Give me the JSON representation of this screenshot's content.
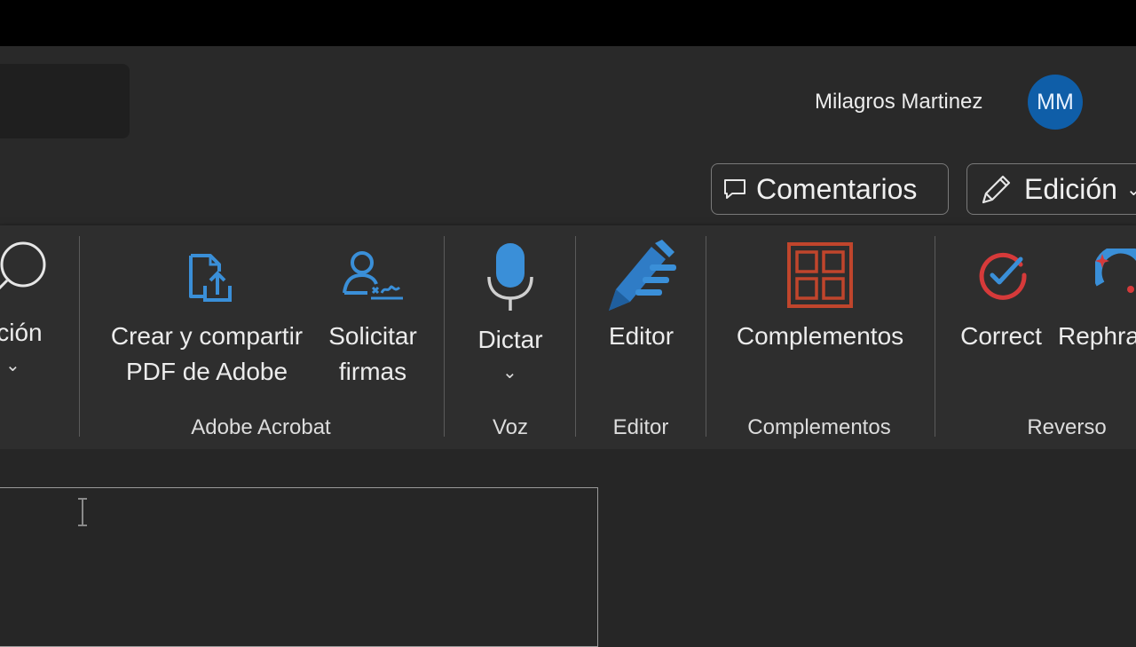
{
  "header": {
    "user_name": "Milagros Martinez",
    "avatar_initials": "MM",
    "comments_label": "Comentarios",
    "editing_label": "Edición"
  },
  "ribbon": {
    "partial_left_label": "ición",
    "groups": {
      "adobe": {
        "label": "Adobe Acrobat",
        "create_pdf_line1": "Crear y compartir",
        "create_pdf_line2": "PDF de Adobe",
        "request_sign_line1": "Solicitar",
        "request_sign_line2": "firmas"
      },
      "voice": {
        "label": "Voz",
        "dictate_label": "Dictar"
      },
      "editor": {
        "label": "Editor",
        "editor_label": "Editor"
      },
      "addins": {
        "label": "Complementos",
        "addins_label": "Complementos"
      },
      "reverso": {
        "label": "Reverso",
        "correct_label": "Correct",
        "rephrase_label": "Rephra"
      }
    }
  },
  "icons": {
    "search": "search-icon",
    "comment": "comment-icon",
    "pencil": "pencil-icon",
    "pdf_share": "pdf-share-icon",
    "signature": "signature-icon",
    "microphone": "microphone-icon",
    "editor": "editor-pen-icon",
    "addins": "addins-grid-icon",
    "correct": "correct-check-icon",
    "rephrase": "rephrase-icon"
  },
  "colors": {
    "accent_blue": "#3a8fd8",
    "addins_red": "#c0452c",
    "correct_red": "#d63a3a",
    "avatar_blue": "#0f5ea8"
  }
}
